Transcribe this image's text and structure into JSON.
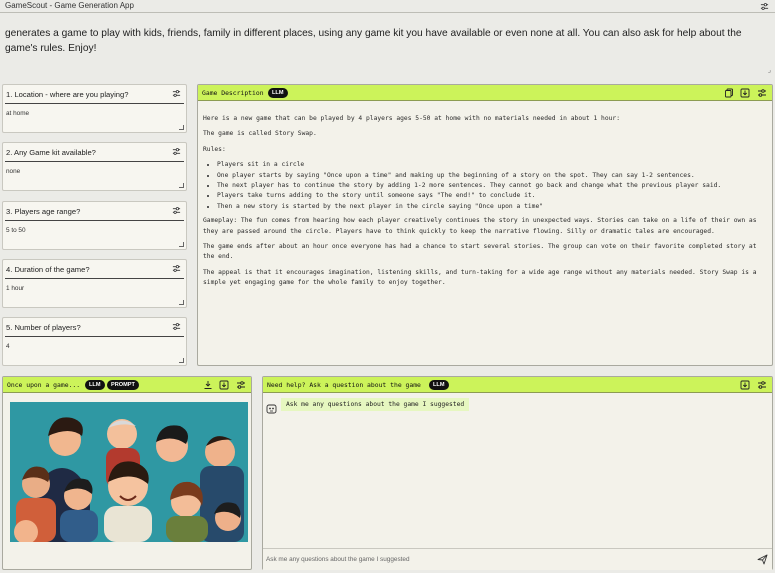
{
  "app": {
    "title": "GameScout - Game Generation App",
    "intro": "generates a game to play with kids, friends, family in different places, using any game kit you have available or even none at all. You can also ask for help about the game's rules. Enjoy!",
    "colors": {
      "accent": "#ccf35a",
      "background": "#ebebe7",
      "badge": "#111111"
    }
  },
  "fields": [
    {
      "label": "1. Location - where are you playing?",
      "value": "at home"
    },
    {
      "label": "2. Any Game kit available?",
      "value": "none"
    },
    {
      "label": "3. Players age range?",
      "value": "5 to 50"
    },
    {
      "label": "4. Duration of the game?",
      "value": "1 hour"
    },
    {
      "label": "5. Number of players?",
      "value": "4"
    }
  ],
  "description": {
    "title": "Game Description",
    "badge": "LLM",
    "para1": "Here is a new game that can be played by 4 players ages 5-50 at home with no materials needed in about 1 hour:",
    "para2": "The game is called Story Swap.",
    "rules_heading": "Rules:",
    "rules": [
      "Players sit in a circle",
      "One player starts by saying \"Once upon a time\" and making up the beginning of a story on the spot. They can say 1-2 sentences.",
      "The next player has to continue the story by adding 1-2 more sentences. They cannot go back and change what the previous player said.",
      "Players take turns adding to the story until someone says \"The end!\" to conclude it.",
      "Then a new story is started by the next player in the circle saying \"Once upon a time\""
    ],
    "para3": "Gameplay: The fun comes from hearing how each player creatively continues the story in unexpected ways. Stories can take on a life of their own as they are passed around the circle. Players have to think quickly to keep the narrative flowing. Silly or dramatic tales are encouraged.",
    "para4": "The game ends after about an hour once everyone has had a chance to start several stories. The group can vote on their favorite completed story at the end.",
    "para5": "The appeal is that it encourages imagination, listening skills, and turn-taking for a wide age range without any materials needed. Story Swap is a simple yet engaging game for the whole family to enjoy together."
  },
  "image_panel": {
    "title": "Once upon a game...",
    "badge_llm": "LLM",
    "badge_prompt": "PROMPT",
    "image_icon": "family-group-illustration"
  },
  "chat": {
    "title": "Need help? Ask a question about the game",
    "badge": "LLM",
    "message": "Ask me any questions about the game I suggested",
    "placeholder": "Ask me any questions about the game I suggested"
  },
  "icons": [
    "tune-icon",
    "copy-icon",
    "download-icon",
    "bot-icon",
    "send-icon"
  ]
}
